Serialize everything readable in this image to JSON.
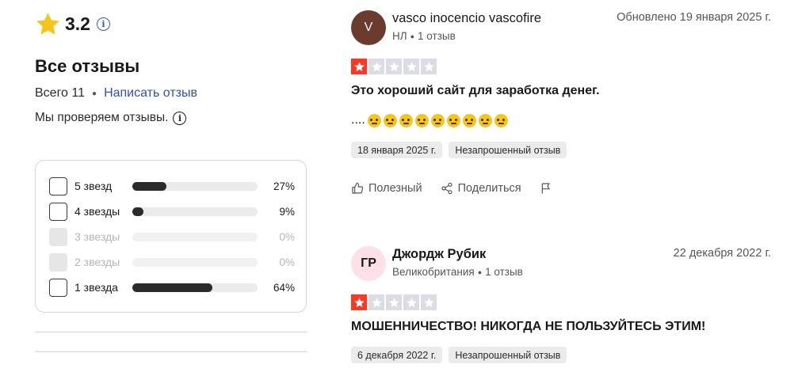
{
  "summary": {
    "rating": "3.2",
    "title": "Все отзывы",
    "total": "Всего 11",
    "write_review": "Написать отзыв",
    "verify_text": "Мы проверяем отзывы."
  },
  "filters": [
    {
      "label": "5 звезд",
      "percent": "27%",
      "fill": 0.27,
      "enabled": true
    },
    {
      "label": "4 звезды",
      "percent": "9%",
      "fill": 0.09,
      "enabled": true
    },
    {
      "label": "3 звезды",
      "percent": "0%",
      "fill": 0,
      "enabled": false
    },
    {
      "label": "2 звезды",
      "percent": "0%",
      "fill": 0,
      "enabled": false
    },
    {
      "label": "1 звезда",
      "percent": "64%",
      "fill": 0.64,
      "enabled": true
    }
  ],
  "reviews": [
    {
      "avatar_initials": "V",
      "author": "vasco inocencio vascofire",
      "country": "НЛ",
      "review_count": "1 отзыв",
      "updated": "Обновлено 19 января 2025 г.",
      "stars": 1,
      "title": "Это хороший сайт для заработка денег.",
      "text": "....",
      "emoji_count": 9,
      "date_tag": "18 января 2025 г.",
      "type_tag": "Незапрошенный отзыв",
      "helpful": "Полезный",
      "share": "Поделиться"
    },
    {
      "avatar_initials": "ГР",
      "author": "Джордж Рубик",
      "country": "Великобритания",
      "review_count": "1 отзыв",
      "updated": "22 декабря 2022 г.",
      "stars": 1,
      "title": "МОШЕННИЧЕСТВО! НИКОГДА НЕ ПОЛЬЗУЙТЕСЬ ЭТИМ!",
      "date_tag": "6 декабря 2022 г.",
      "type_tag": "Незапрошенный отзыв"
    }
  ],
  "colors": {
    "accent_link": "#2d4fc2",
    "star_red": "#ff3722",
    "star_grey": "#dcdce6",
    "star_gold": "#f5c518"
  }
}
